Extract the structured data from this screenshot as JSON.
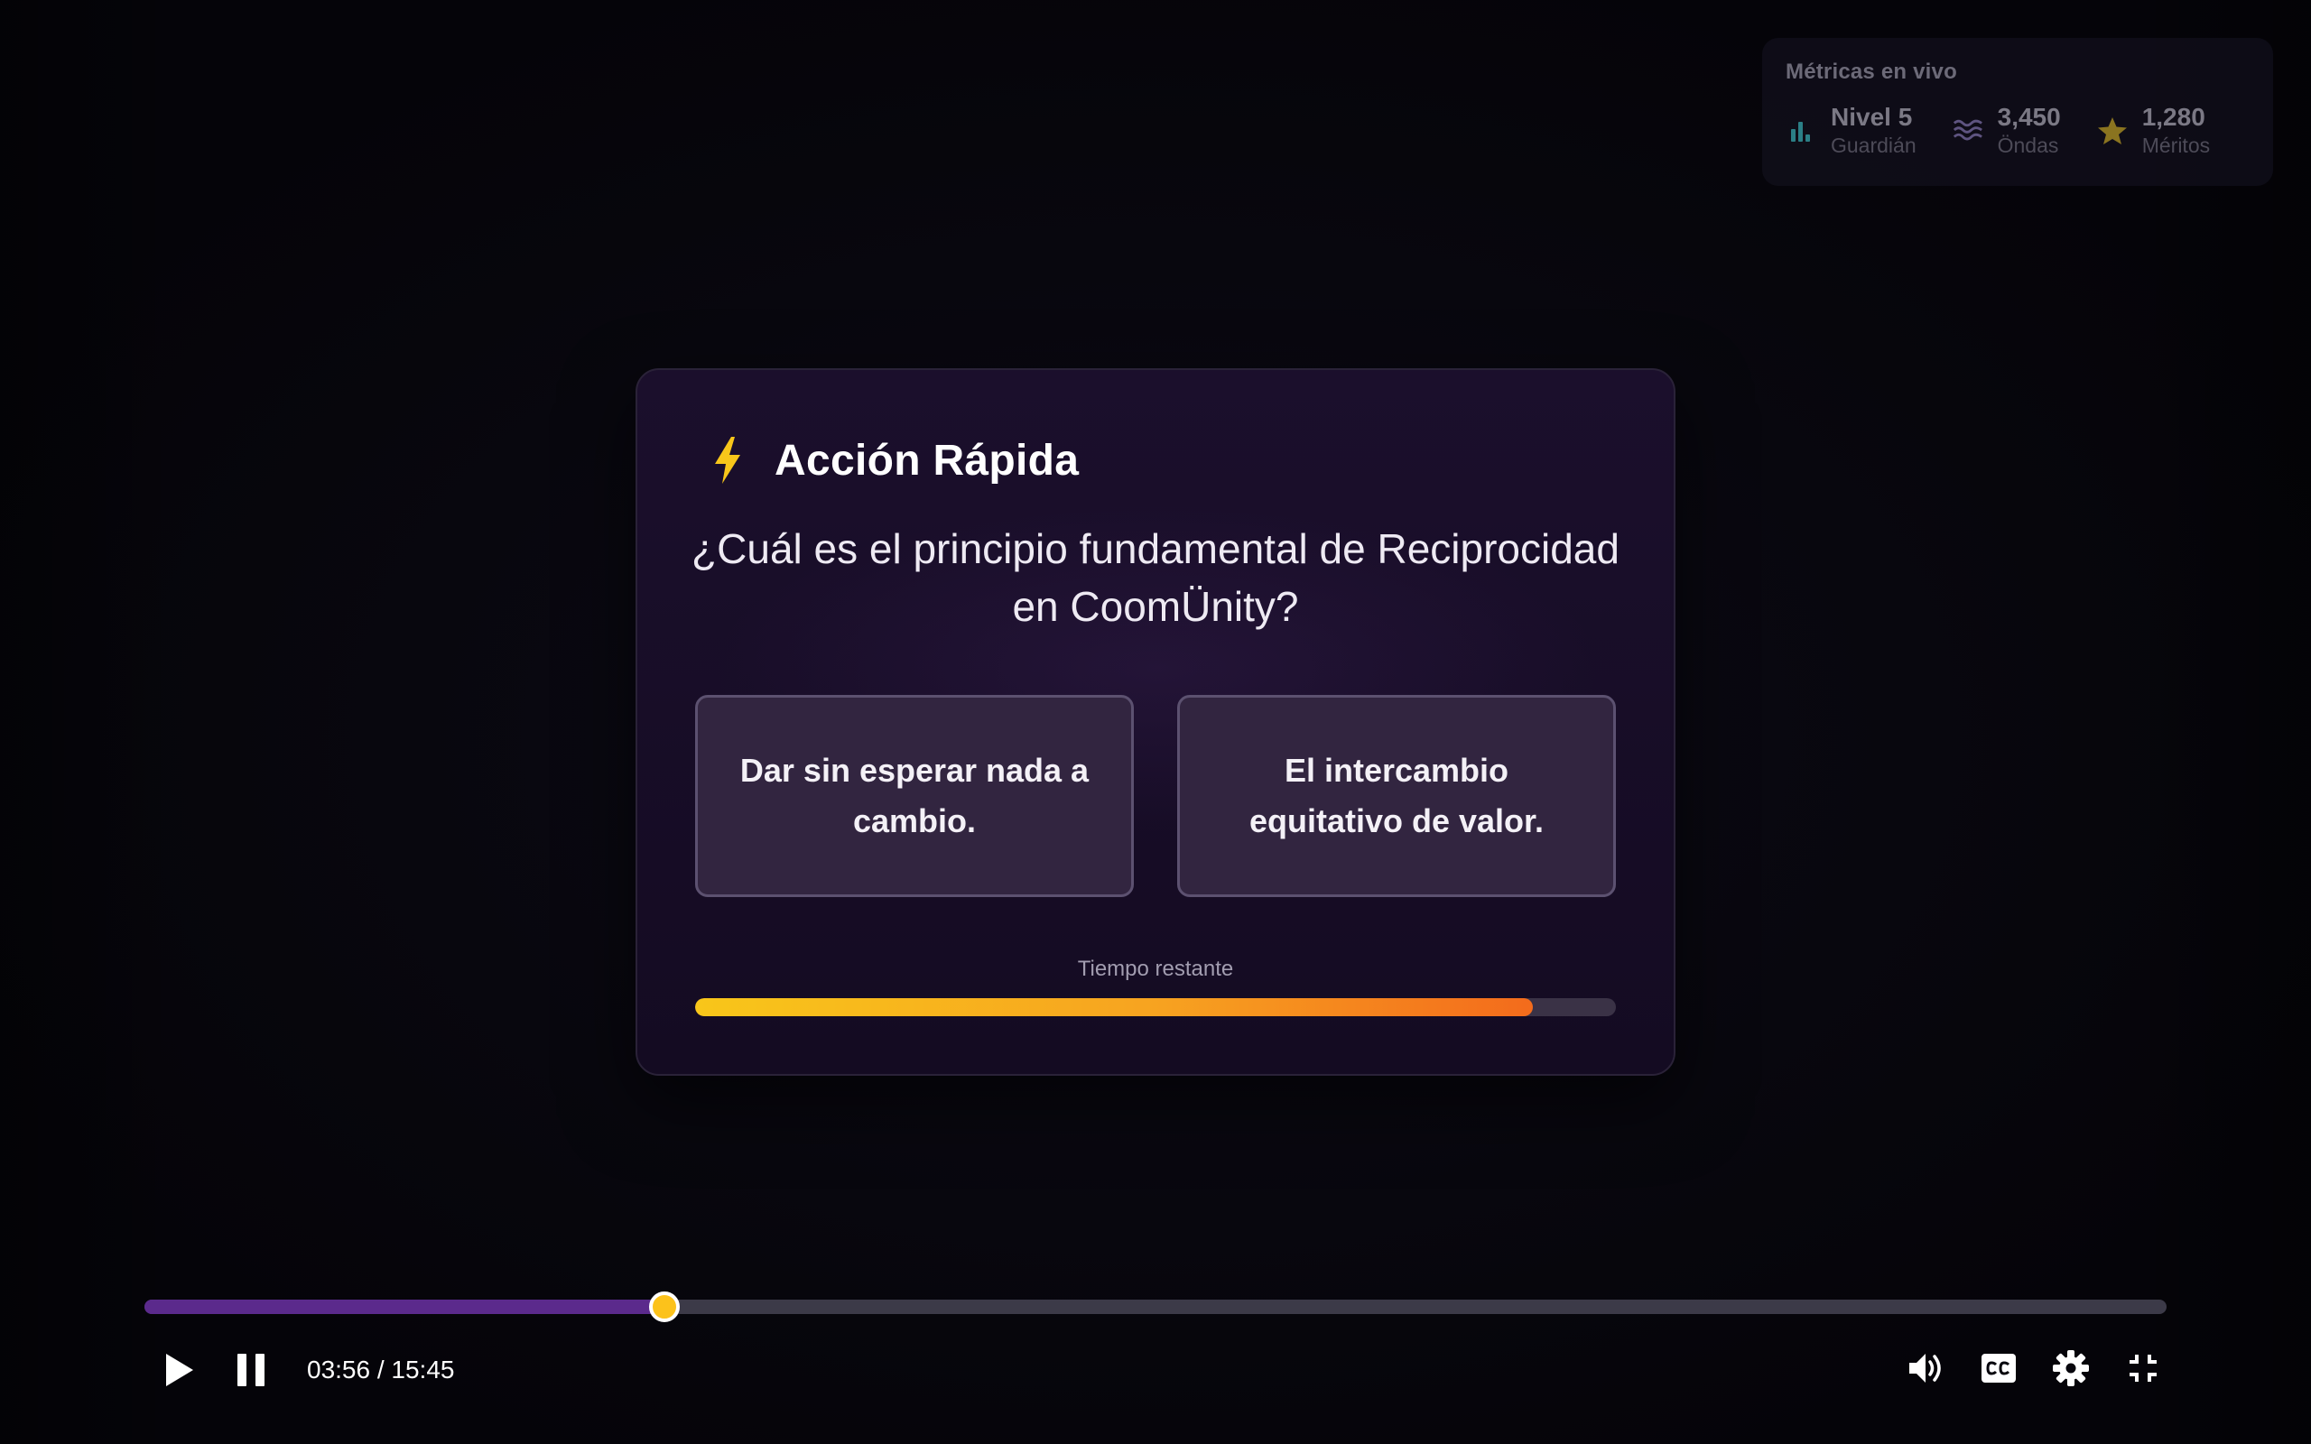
{
  "metrics": {
    "title": "Métricas en vivo",
    "items": [
      {
        "icon": "bar-chart-icon",
        "value": "Nivel 5",
        "label": "Guardián",
        "color": "#2b7f86"
      },
      {
        "icon": "waves-icon",
        "value": "3,450",
        "label": "Öndas",
        "color": "#5e5480"
      },
      {
        "icon": "star-icon",
        "value": "1,280",
        "label": "Méritos",
        "color": "#8a7420"
      }
    ]
  },
  "quiz": {
    "icon": "lightning-bolt-icon",
    "title": "Acción Rápida",
    "question": "¿Cuál es el principio fundamental de Reciprocidad en CoomÜnity?",
    "answers": [
      {
        "label": "Dar sin esperar nada a cambio."
      },
      {
        "label": "El intercambio equitativo de valor."
      }
    ],
    "timer_label": "Tiempo restante",
    "timer_remaining_fraction": 0.91
  },
  "player": {
    "current_time": "03:56",
    "duration": "15:45",
    "time_text": "03:56 / 15:45",
    "progress_fraction": 0.257,
    "controls_left": [
      "play-icon",
      "pause-icon"
    ],
    "controls_right": [
      "volume-icon",
      "closed-captions-icon",
      "settings-gear-icon",
      "exit-fullscreen-icon"
    ]
  },
  "colors": {
    "accent_purple": "#5b2a8c",
    "thumb_yellow": "#fcc21b",
    "bolt_yellow": "#f8c61a",
    "timer_orange": "#f36b1c"
  }
}
